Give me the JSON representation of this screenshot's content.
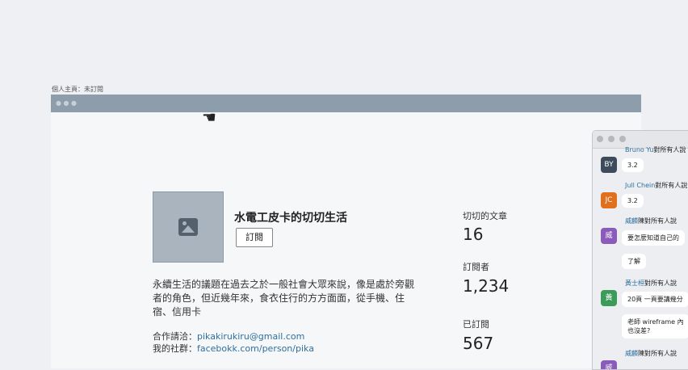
{
  "page_caption": "個人主頁：未訂閱",
  "blog": {
    "title": "水電工皮卡的切切生活",
    "subscribe_label": "訂閱",
    "description": "永續生活的議題在過去之於一般社會大眾來說，像是處於旁觀者的角色，但近幾年來，食衣住行的方方面面，從手機、住宿、信用卡",
    "contact_label": "合作請洽：",
    "contact_email": "pikakirukiru@gmail.com",
    "social_label": "我的社群：",
    "social_link": "facebokk.com/person/pika"
  },
  "stats": [
    {
      "label": "切切的文章",
      "value": "16"
    },
    {
      "label": "訂閱者",
      "value": "1,234"
    },
    {
      "label": "已訂閱",
      "value": "567"
    }
  ],
  "chat": {
    "messages": [
      {
        "initials": "BY",
        "avatar_color": "#3d4b5a",
        "name": "Bruno Yu",
        "suffix": "對所有人說",
        "text": "3.2"
      },
      {
        "initials": "JC",
        "avatar_color": "#e06f1e",
        "name": "Jull Chein",
        "suffix": "對所有人說",
        "text": "3.2"
      },
      {
        "initials": "威",
        "avatar_color": "#8a5bb8",
        "name": "威麟",
        "suffix": "陳對所有人說",
        "text": "要怎麼知道自己的",
        "text2": "了解"
      },
      {
        "initials": "黃",
        "avatar_color": "#3c9a5a",
        "name": "黃士桓",
        "suffix": "對所有人說",
        "text": "20頁 一頁要講幾分",
        "text2": "老師 wireframe 內",
        "text3": "也沒差?"
      },
      {
        "initials": "威",
        "avatar_color": "#8a5bb8",
        "name": "威麟",
        "suffix": "陳對所有人說"
      }
    ]
  }
}
